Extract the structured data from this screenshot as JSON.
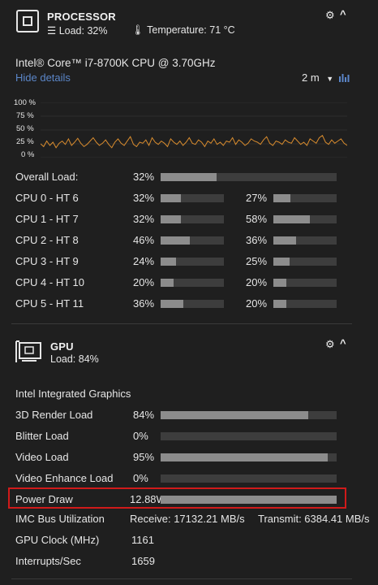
{
  "processor": {
    "title": "PROCESSOR",
    "load_text": "Load: 32%",
    "temp_text": "Temperature: 71 °C",
    "cpu_name": "Intel® Core™ i7-8700K CPU @ 3.70GHz",
    "hide_details": "Hide details",
    "time_range": "2 m",
    "chart_y_labels": [
      "100 %",
      "75 %",
      "50 %",
      "25 %",
      "0 %"
    ],
    "overall": {
      "label": "Overall Load:",
      "value": "32%",
      "fraction": 0.32
    },
    "cores": [
      {
        "label": "CPU 0 - HT 6",
        "a": "32%",
        "a_frac": 0.32,
        "b": "27%",
        "b_frac": 0.27
      },
      {
        "label": "CPU 1 - HT 7",
        "a": "32%",
        "a_frac": 0.32,
        "b": "58%",
        "b_frac": 0.58
      },
      {
        "label": "CPU 2 - HT 8",
        "a": "46%",
        "a_frac": 0.46,
        "b": "36%",
        "b_frac": 0.36
      },
      {
        "label": "CPU 3 - HT 9",
        "a": "24%",
        "a_frac": 0.24,
        "b": "25%",
        "b_frac": 0.25
      },
      {
        "label": "CPU 4 - HT 10",
        "a": "20%",
        "a_frac": 0.2,
        "b": "20%",
        "b_frac": 0.2
      },
      {
        "label": "CPU 5 - HT 11",
        "a": "36%",
        "a_frac": 0.36,
        "b": "20%",
        "b_frac": 0.2
      }
    ]
  },
  "gpu": {
    "title": "GPU",
    "load_text": "Load: 84%",
    "name": "Intel Integrated Graphics",
    "rows": [
      {
        "label": "3D Render Load",
        "value": "84%",
        "fraction": 0.84
      },
      {
        "label": "Blitter Load",
        "value": "0%",
        "fraction": 0.0
      },
      {
        "label": "Video Load",
        "value": "95%",
        "fraction": 0.95
      },
      {
        "label": "Video Enhance Load",
        "value": "0%",
        "fraction": 0.0
      },
      {
        "label": "Power Draw",
        "value": "12.88W",
        "fraction": 1.0
      }
    ],
    "imc": {
      "label": "IMC Bus Utilization",
      "receive": "Receive: 17132.21 MB/s",
      "transmit": "Transmit: 6384.41 MB/s"
    },
    "clock": {
      "label": "GPU Clock (MHz)",
      "value": "1161"
    },
    "interrupts": {
      "label": "Interrupts/Sec",
      "value": "1659"
    }
  },
  "colors": {
    "accent_line": "#d98c2e",
    "highlight": "#d01a1a",
    "link": "#5b86c8"
  },
  "chart_data": {
    "type": "line",
    "ylim": [
      0,
      100
    ],
    "y_ticks": [
      "100 %",
      "75 %",
      "50 %",
      "25 %",
      "0 %"
    ],
    "series": [
      {
        "values": [
          25,
          20,
          30,
          22,
          28,
          18,
          26,
          30,
          24,
          34,
          22,
          28,
          35,
          26,
          20,
          24,
          30,
          36,
          28,
          22,
          26,
          32,
          24,
          18,
          28,
          34,
          26,
          22,
          30,
          38,
          24,
          20,
          28,
          26,
          32,
          22,
          36,
          28,
          24,
          30,
          26,
          20,
          34,
          28,
          24,
          30,
          22,
          28,
          36,
          26,
          24,
          32,
          28,
          20,
          30,
          26,
          34,
          24,
          28,
          22,
          30,
          28,
          36,
          24,
          32,
          28,
          22,
          26,
          34,
          30,
          28,
          24,
          32,
          38,
          26,
          22,
          30,
          28,
          24,
          32,
          28,
          26,
          36,
          30,
          24,
          28,
          22,
          34,
          30,
          26,
          36,
          40,
          28,
          24,
          32,
          26,
          30,
          34,
          26,
          22
        ]
      }
    ]
  }
}
